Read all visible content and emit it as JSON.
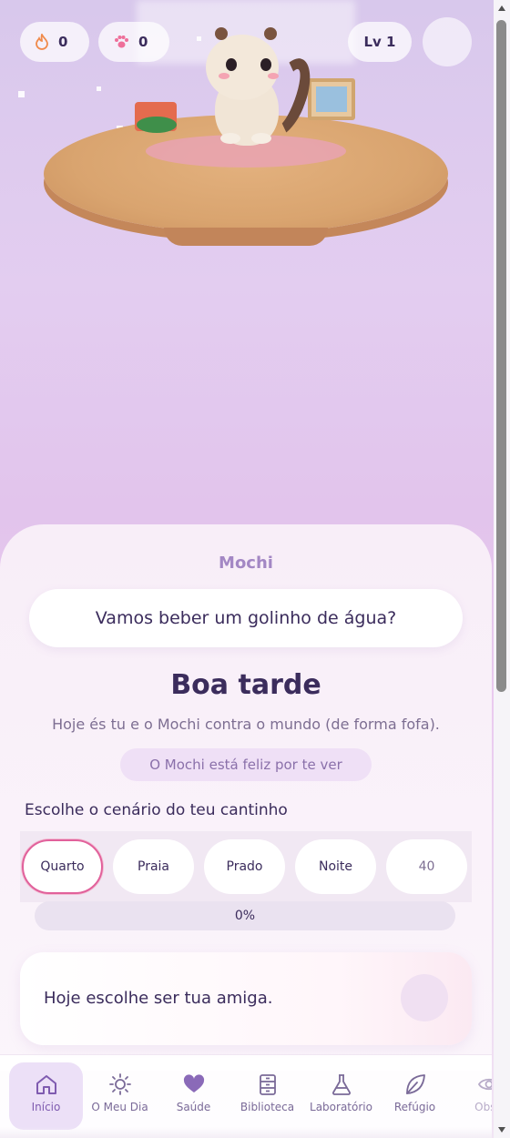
{
  "top_bar": {
    "streak_icon": "flame-icon",
    "streak_count": "0",
    "paws_icon": "paw-icon",
    "paws_count": "0",
    "level_label": "Lv 1"
  },
  "pet": {
    "name": "Mochi",
    "speech": "Vamos beber um golinho de água?"
  },
  "home": {
    "greeting": "Boa tarde",
    "subtitle": "Hoje és tu e o Mochi contra o mundo (de forma fofa).",
    "status": "O Mochi está feliz por te ver"
  },
  "scenery": {
    "label": "Escolhe o cenário do teu cantinho",
    "options": [
      "Quarto",
      "Praia",
      "Prado",
      "Noite",
      "40"
    ],
    "selected": "Quarto"
  },
  "progress": {
    "label": "0%",
    "value": 0
  },
  "card": {
    "text": "Hoje escolhe ser tua amiga."
  },
  "nav": {
    "items": [
      {
        "label": "Início",
        "icon": "home-icon"
      },
      {
        "label": "O Meu Dia",
        "icon": "sun-icon"
      },
      {
        "label": "Saúde",
        "icon": "heart-icon"
      },
      {
        "label": "Biblioteca",
        "icon": "cabinet-icon"
      },
      {
        "label": "Laboratório",
        "icon": "flask-icon"
      },
      {
        "label": "Refúgio",
        "icon": "leaf-icon"
      },
      {
        "label": "Obse",
        "icon": "eye-icon"
      }
    ],
    "active": "Início"
  },
  "colors": {
    "accent": "#7f5bb0",
    "selected_border": "#e1619b",
    "text": "#3b2c5c"
  }
}
